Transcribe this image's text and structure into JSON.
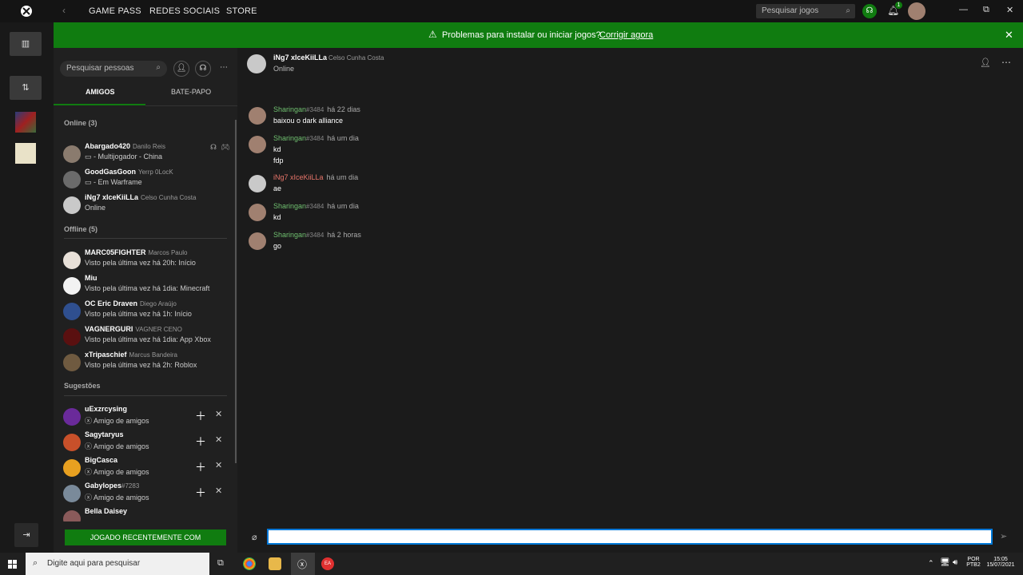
{
  "top_nav": {
    "links": [
      "GAME PASS",
      "REDES SOCIAIS",
      "STORE"
    ],
    "search_placeholder": "Pesquisar jogos",
    "notification_count": "1"
  },
  "banner": {
    "message": "Problemas para instalar ou iniciar jogos?",
    "link": "Corrigir agora"
  },
  "friends": {
    "search_placeholder": "Pesquisar pessoas",
    "tabs": [
      "AMIGOS",
      "BATE-PAPO"
    ],
    "online_header": "Online (3)",
    "offline_header": "Offline (5)",
    "suggestions_header": "Sugestões",
    "online": [
      {
        "gamertag": "Abargado420",
        "real_name": "Danilo Reis",
        "status": "▭ - Multijogador - China"
      },
      {
        "gamertag": "GoodGasGoon",
        "real_name": "Yerrp 0LocK",
        "status": "▭ - Em Warframe"
      },
      {
        "gamertag": "iNg7 xIceKiiLLa",
        "real_name": "Celso Cunha Costa",
        "status": "Online"
      }
    ],
    "offline": [
      {
        "gamertag": "MARC05FIGHTER",
        "real_name": "Marcos Paulo",
        "status": "Visto pela última vez há 20h: Início"
      },
      {
        "gamertag": "Miu",
        "real_name": "",
        "status": "Visto pela última vez há 1dia: Minecraft"
      },
      {
        "gamertag": "OC Eric Draven",
        "real_name": "Diego Araújo",
        "status": "Visto pela última vez há 1h: Início"
      },
      {
        "gamertag": "VAGNERGURI",
        "real_name": "VAGNER CENO",
        "status": "Visto pela última vez há 1dia: App Xbox"
      },
      {
        "gamertag": "xTripaschief",
        "real_name": "Marcus Bandeira",
        "status": "Visto pela última vez há 2h: Roblox"
      }
    ],
    "suggestions": [
      {
        "gamertag": "uExzrcysing",
        "real_name": "",
        "status": "Amigo de amigos"
      },
      {
        "gamertag": "Sagytaryus",
        "real_name": "",
        "status": "Amigo de amigos"
      },
      {
        "gamertag": "BigCasca",
        "real_name": "",
        "status": "Amigo de amigos"
      },
      {
        "gamertag": "Gabylopes",
        "real_name": "#7283",
        "status": "Amigo de amigos"
      },
      {
        "gamertag": "Bella Daisey",
        "real_name": "",
        "status": ""
      }
    ],
    "recent_button": "JOGADO RECENTEMENTE COM"
  },
  "chat": {
    "header": {
      "gamertag": "iNg7 xIceKiiLLa",
      "real_name": "Celso Cunha Costa",
      "status": "Online"
    },
    "messages": [
      {
        "author": "Sharingan",
        "tag": "#3484",
        "time": "há 22 dias",
        "lines": [
          "baixou o dark alliance"
        ]
      },
      {
        "author": "Sharingan",
        "tag": "#3484",
        "time": "há um dia",
        "lines": [
          "kd",
          "fdp"
        ]
      },
      {
        "author": "iNg7 xIceKiiLLa",
        "tag": "",
        "time": "há um dia",
        "lines": [
          "ae"
        ]
      },
      {
        "author": "Sharingan",
        "tag": "#3484",
        "time": "há um dia",
        "lines": [
          "kd"
        ]
      },
      {
        "author": "Sharingan",
        "tag": "#3484",
        "time": "há 2 horas",
        "lines": [
          "go"
        ]
      }
    ],
    "input_value": ""
  },
  "taskbar": {
    "search_placeholder": "Digite aqui para pesquisar",
    "lang": "POR",
    "layout": "PTB2",
    "time": "15:05",
    "date": "15/07/2021"
  },
  "colors": {
    "accent": "#107c10",
    "author_self": "#107c10",
    "author_friend": "#e8756a"
  }
}
